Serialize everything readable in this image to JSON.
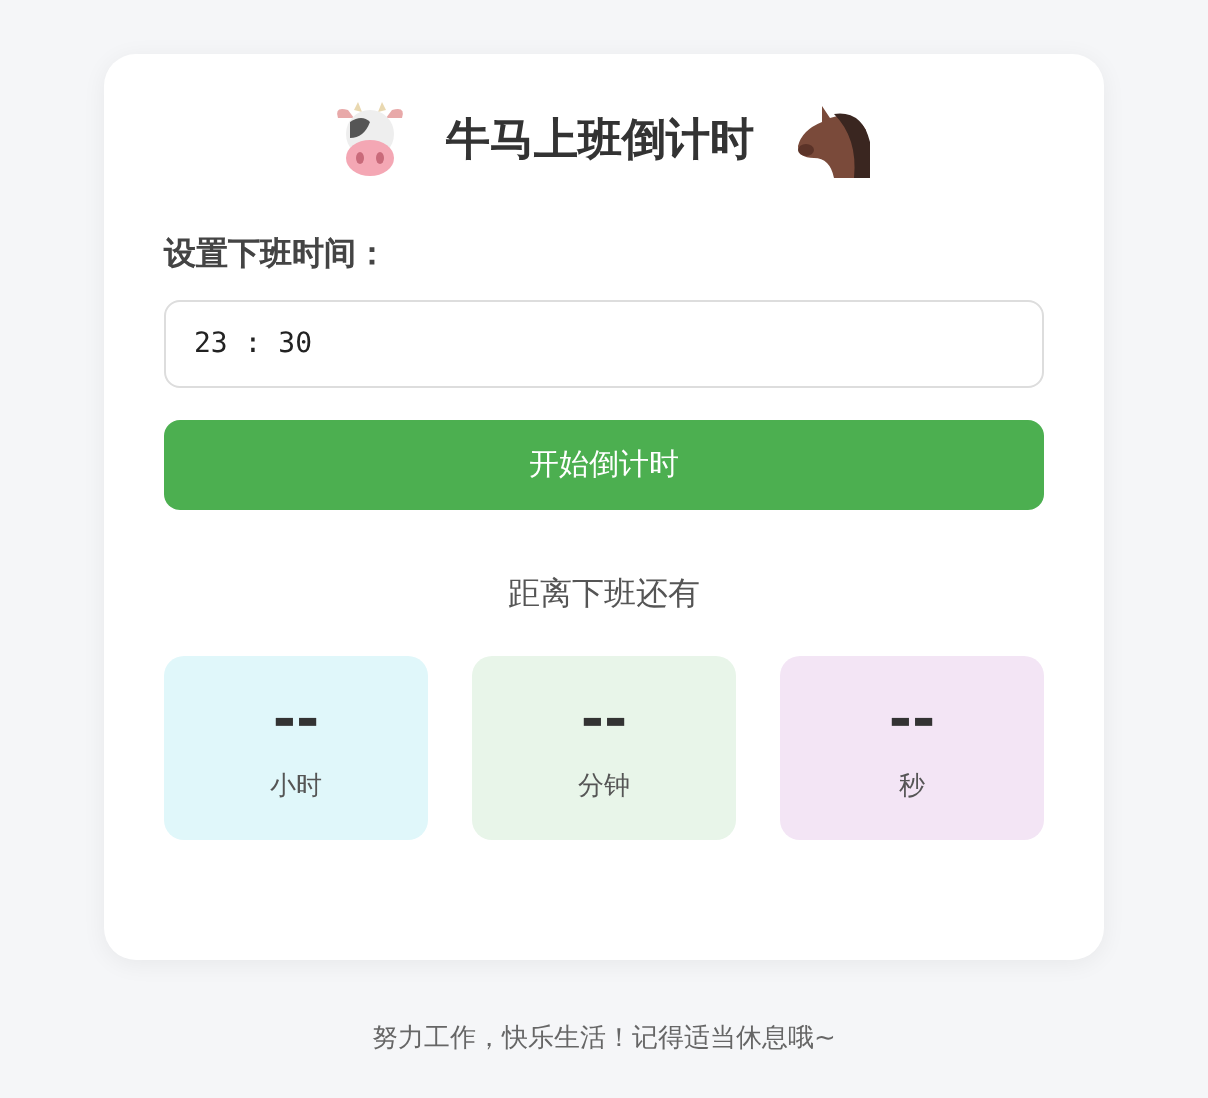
{
  "title": "牛马上班倒计时",
  "time_label": "设置下班时间：",
  "time_input": {
    "value": "23 : 30"
  },
  "start_button": "开始倒计时",
  "countdown_heading": "距离下班还有",
  "units": [
    {
      "value": "--",
      "label": "小时",
      "color": "#e0f7fa"
    },
    {
      "value": "--",
      "label": "分钟",
      "color": "#e8f5e9"
    },
    {
      "value": "--",
      "label": "秒",
      "color": "#f3e5f5"
    }
  ],
  "footer": "努力工作，快乐生活！记得适当休息哦~"
}
